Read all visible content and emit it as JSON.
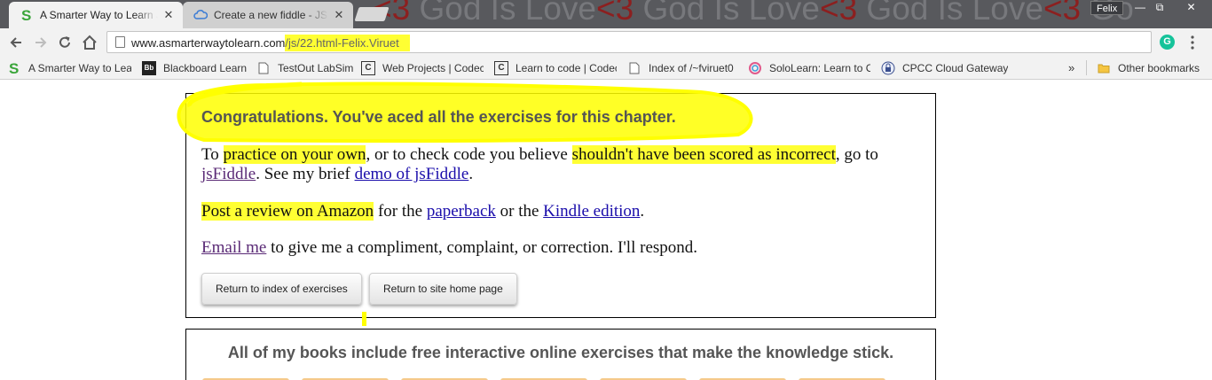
{
  "browser": {
    "tabs": [
      {
        "title": "A Smarter Way to Learn JavaScript",
        "active": true
      },
      {
        "title": "Create a new fiddle - JSFiddle",
        "active": false
      }
    ],
    "background_text": [
      "<3",
      " God Is Love",
      "<3",
      " God Is Love",
      "<3",
      " God Is Love",
      "<3",
      " Go"
    ],
    "profile_name": "Felix",
    "window_controls": {
      "minimize": "—",
      "restore": "⧉",
      "close": "✕"
    },
    "url_domain": "www.asmarterwaytolearn.com",
    "url_path": "/js/22.html-Felix.Viruet",
    "grammarly_letter": "G",
    "menu_dots": "⋮"
  },
  "bookmarks": {
    "items": [
      {
        "label": "A Smarter Way to Learn",
        "icon": "s-logo-icon"
      },
      {
        "label": "Blackboard Learn",
        "icon": "blackboard-icon",
        "badge": "Bb"
      },
      {
        "label": "TestOut LabSim",
        "icon": "page-icon"
      },
      {
        "label": "Web Projects | Codecademy",
        "icon": "codecademy-icon"
      },
      {
        "label": "Learn to code | Codecademy",
        "icon": "codecademy-icon"
      },
      {
        "label": "Index of /~fviruet0",
        "icon": "page-icon"
      },
      {
        "label": "SoloLearn: Learn to Code",
        "icon": "sololearn-icon"
      },
      {
        "label": "CPCC Cloud Gateway",
        "icon": "gateway-icon"
      }
    ],
    "overflow": "»",
    "other": "Other bookmarks"
  },
  "content": {
    "heading": "Congratulations. You've aced all the exercises for this chapter.",
    "p1": {
      "a": "To ",
      "b": "practice on your own",
      "c": ", or to check code you believe ",
      "d": "shouldn't have been scored as incorrect",
      "e": ", go to ",
      "link1": "jsFiddle",
      "f": ". See my brief ",
      "link2": "demo of jsFiddle",
      "g": "."
    },
    "p2": {
      "a": "Post a review on Amazon",
      "b": " for the ",
      "link1": "paperback",
      "c": " or the ",
      "link2": "Kindle edition",
      "d": "."
    },
    "p3": {
      "link": "Email me",
      "a": " to give me a compliment, complaint, or correction. I'll respond."
    },
    "buttons": {
      "index": "Return to index of exercises",
      "home": "Return to site home page"
    },
    "promo": "All of my books include free interactive online exercises that make the knowledge stick."
  },
  "colors": {
    "highlight": "#ffff33",
    "link": "#1a0dab",
    "visited_link": "#5a2a76",
    "heading_gray": "#555555"
  }
}
